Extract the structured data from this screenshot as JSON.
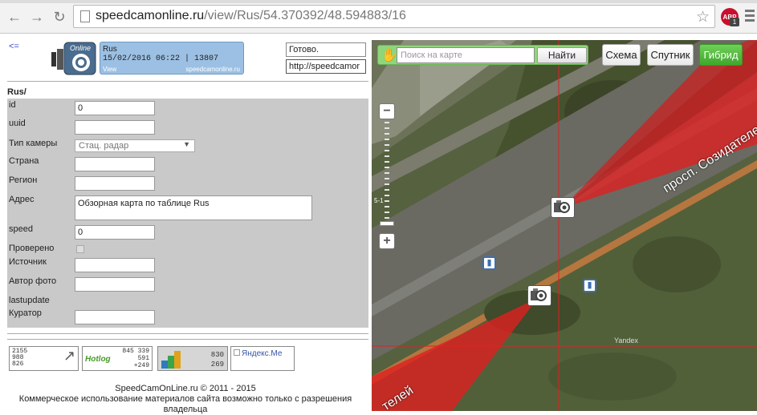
{
  "browser": {
    "url_host": "speedcamonline.ru",
    "url_path": "/view/Rus/54.370392/48.594883/16",
    "adblock_label": "ABP",
    "adblock_count": "1"
  },
  "header": {
    "back_link": "<=",
    "info_line1": "Rus",
    "info_line2": "15/02/2016 06:22 | 13807",
    "info_view": "View",
    "info_site": "speedcamonline.ru",
    "status_text": "Готово.",
    "status_url": "http://speedcamor"
  },
  "form": {
    "title": "Rus/",
    "fields": {
      "id": {
        "label": "id",
        "value": "0"
      },
      "uuid": {
        "label": "uuid",
        "value": ""
      },
      "camera_type": {
        "label": "Тип камеры",
        "value": "Стац. радар"
      },
      "country": {
        "label": "Страна",
        "value": ""
      },
      "region": {
        "label": "Регион",
        "value": ""
      },
      "address": {
        "label": "Адрес",
        "value": "Обзорная карта по таблице Rus"
      },
      "speed": {
        "label": "speed",
        "value": "0"
      },
      "verified": {
        "label": "Проверено"
      },
      "source": {
        "label": "Источник",
        "value": ""
      },
      "photo_author": {
        "label": "Автор фото",
        "value": ""
      },
      "lastupdate": {
        "label": "lastupdate"
      },
      "curator": {
        "label": "Куратор",
        "value": ""
      }
    }
  },
  "counters": {
    "c1": [
      "2155",
      "988",
      "826"
    ],
    "c2_brand": "Hotlog",
    "c2": [
      "845 339",
      "591",
      "+249"
    ],
    "c3": [
      "830",
      "269"
    ],
    "yandex_alt": "Яндекс.Ме"
  },
  "footer": {
    "copyright": "SpeedCamOnLine.ru © 2011 - 2015",
    "notice": "Коммерческое использование материалов сайта возможно только с разрешения владельца"
  },
  "map": {
    "search_placeholder": "Поиск на карте",
    "find_button": "Найти",
    "layer_scheme": "Схема",
    "layer_satellite": "Спутник",
    "layer_hybrid": "Гибрид",
    "active_layer": "Гибрид",
    "zoom_minus": "−",
    "zoom_plus": "+",
    "zoom_label": "5-1",
    "street_label": "просп. Созидателей",
    "street_label_lower": "телей",
    "watermark": "Yandex",
    "camera_icon": "speed-camera-icon",
    "bus_icon": "bus-stop-icon"
  }
}
